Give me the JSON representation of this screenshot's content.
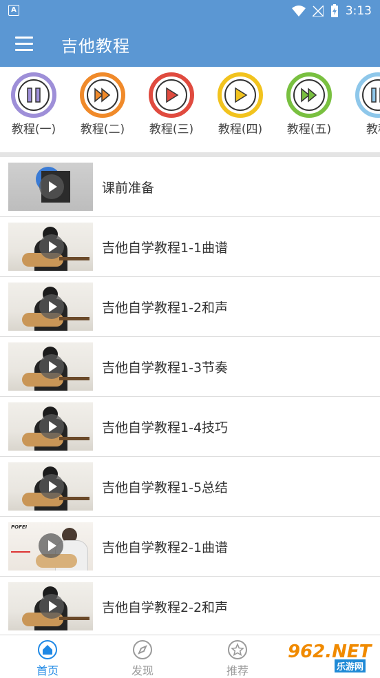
{
  "status_bar": {
    "notification_icon": "A",
    "time": "3:13"
  },
  "app_bar": {
    "title": "吉他教程"
  },
  "categories": [
    {
      "label": "教程(一)",
      "ring_color": "#9e8fd8",
      "icon": "pause-icon"
    },
    {
      "label": "教程(二)",
      "ring_color": "#f08a2a",
      "icon": "fast-forward-icon"
    },
    {
      "label": "教程(三)",
      "ring_color": "#e04b3f",
      "icon": "play-icon"
    },
    {
      "label": "教程(四)",
      "ring_color": "#f2c31e",
      "icon": "play-icon"
    },
    {
      "label": "教程(五)",
      "ring_color": "#79c040",
      "icon": "fast-forward-icon"
    },
    {
      "label": "教程",
      "ring_color": "#8ec7ea",
      "icon": "pause-icon"
    }
  ],
  "lessons": [
    {
      "title": "课前准备",
      "thumb": "intro"
    },
    {
      "title": "吉他自学教程1-1曲谱",
      "thumb": "guitar"
    },
    {
      "title": "吉他自学教程1-2和声",
      "thumb": "guitar"
    },
    {
      "title": "吉他自学教程1-3节奏",
      "thumb": "guitar"
    },
    {
      "title": "吉他自学教程1-4技巧",
      "thumb": "guitar"
    },
    {
      "title": "吉他自学教程1-5总结",
      "thumb": "guitar"
    },
    {
      "title": "吉他自学教程2-1曲谱",
      "thumb": "pofei"
    },
    {
      "title": "吉他自学教程2-2和声",
      "thumb": "guitar"
    }
  ],
  "thumb_brand": "POFEI",
  "bottom_nav": [
    {
      "label": "首页",
      "icon": "home-icon",
      "active": true
    },
    {
      "label": "发现",
      "icon": "compass-icon",
      "active": false
    },
    {
      "label": "推荐",
      "icon": "star-icon",
      "active": false
    }
  ],
  "watermark": {
    "text": "962.NET",
    "sub": "乐游网"
  },
  "colors": {
    "primary": "#5b97d3",
    "active_nav": "#1e88e5",
    "inactive_nav": "#9a9a9a"
  }
}
